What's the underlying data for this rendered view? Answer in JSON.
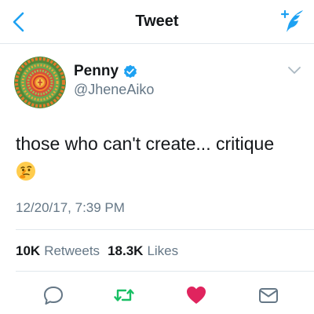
{
  "nav": {
    "title": "Tweet",
    "back_icon": "chevron-left-icon",
    "compose_icon": "compose-tweet-icon",
    "accent": "#1da1f2"
  },
  "tweet": {
    "author": {
      "name": "Penny",
      "handle": "@JheneAiko",
      "verified": true
    },
    "text": "those who can't create... critique",
    "emoji": "thinking-face-emoji",
    "timestamp": "12/20/17, 7:39 PM"
  },
  "stats": {
    "retweets_count": "10K",
    "retweets_label": "Retweets",
    "likes_count": "18.3K",
    "likes_label": "Likes"
  },
  "actions": {
    "reply_icon": "reply-icon",
    "retweet_icon": "retweet-icon",
    "like_icon": "heart-icon",
    "dm_icon": "message-icon",
    "like_color": "#e0245e",
    "retweet_color": "#17bf63"
  }
}
